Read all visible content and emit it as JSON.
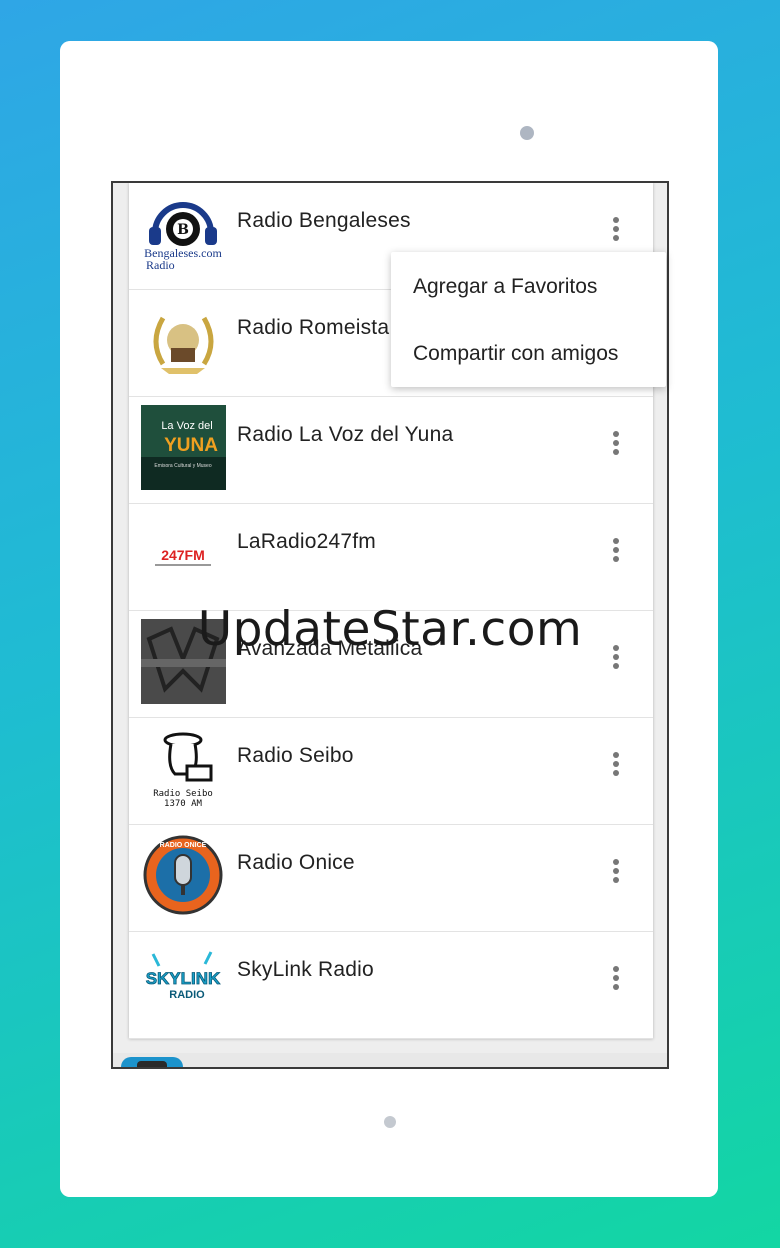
{
  "stations": [
    {
      "name": "Radio Bengaleses",
      "logo": "bengaleses-logo",
      "logo_text": [
        "Bengaleses.com",
        "Radio"
      ]
    },
    {
      "name": "Radio Romeista",
      "logo": "romeista-logo",
      "logo_text": []
    },
    {
      "name": "Radio La Voz del Yuna",
      "logo": "voz-del-yuna-logo",
      "logo_text": [
        "La Voz del",
        "YUNA",
        "Emisora Cultural y Museo"
      ]
    },
    {
      "name": "LaRadio247fm",
      "logo": "laradio247fm-logo",
      "logo_text": [
        "247FM"
      ]
    },
    {
      "name": "Avanzada Metallica",
      "logo": "avanzada-metallica-logo",
      "logo_text": []
    },
    {
      "name": "Radio Seibo",
      "logo": "radio-seibo-logo",
      "logo_text": [
        "Radio Seibo",
        "1370 AM"
      ]
    },
    {
      "name": "Radio Onice",
      "logo": "radio-onice-logo",
      "logo_text": [
        "RADIO ONICE"
      ]
    },
    {
      "name": "SkyLink Radio",
      "logo": "skylink-radio-logo",
      "logo_text": [
        "SKYLINK",
        "RADIO"
      ]
    }
  ],
  "context_menu": {
    "items": [
      "Agregar a Favoritos",
      "Compartir con amigos"
    ]
  },
  "watermark": "UpdateStar.com",
  "colors": {
    "background_start": "#2fa6e6",
    "background_end": "#13d6a3",
    "text": "#222222",
    "more_icon": "#777777"
  },
  "icons": {
    "row_menu": "more-vert-icon"
  }
}
